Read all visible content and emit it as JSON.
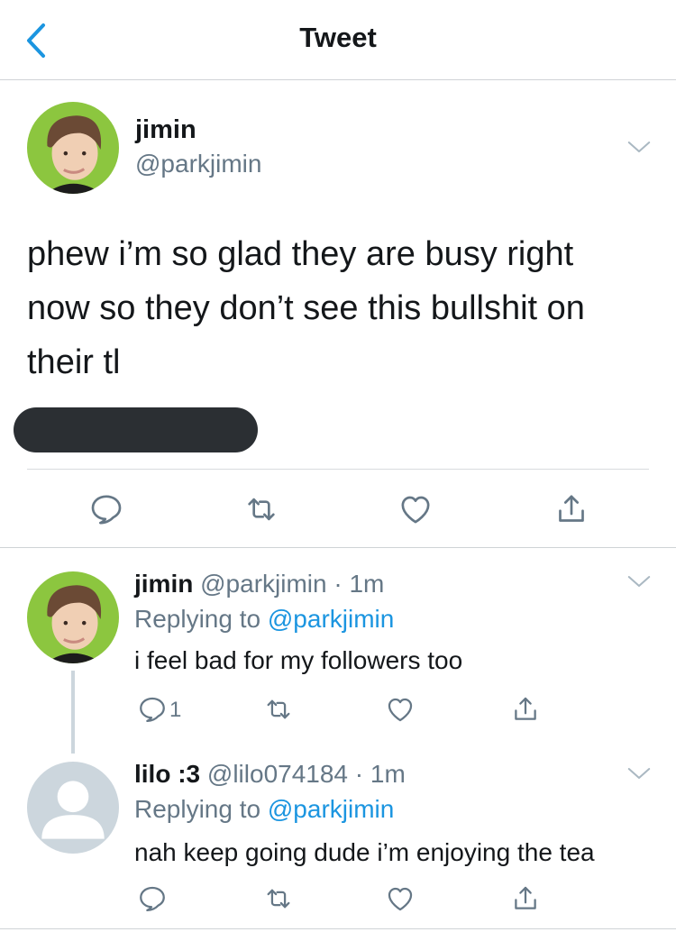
{
  "header": {
    "title": "Tweet"
  },
  "main_tweet": {
    "display_name": "jimin",
    "handle": "@parkjimin",
    "text_lines": [
      "phew i’m so glad they are busy right",
      "now so they don’t see this bullshit on",
      "their tl"
    ]
  },
  "replies": [
    {
      "display_name": "jimin",
      "handle": "@parkjimin",
      "sep": "·",
      "time": "1m",
      "replying_label": "Replying to",
      "replying_handle": "@parkjimin",
      "text": "i feel bad for my followers too",
      "reply_count": "1"
    },
    {
      "display_name": "lilo :3",
      "handle": "@lilo074184",
      "sep": "·",
      "time": "1m",
      "replying_label": "Replying to",
      "replying_handle": "@parkjimin",
      "text": "nah keep going dude i’m enjoying the tea",
      "reply_count": ""
    }
  ],
  "colors": {
    "accent": "#1b95e0",
    "muted": "#657786",
    "avatar_bg": "#8cc63f"
  }
}
